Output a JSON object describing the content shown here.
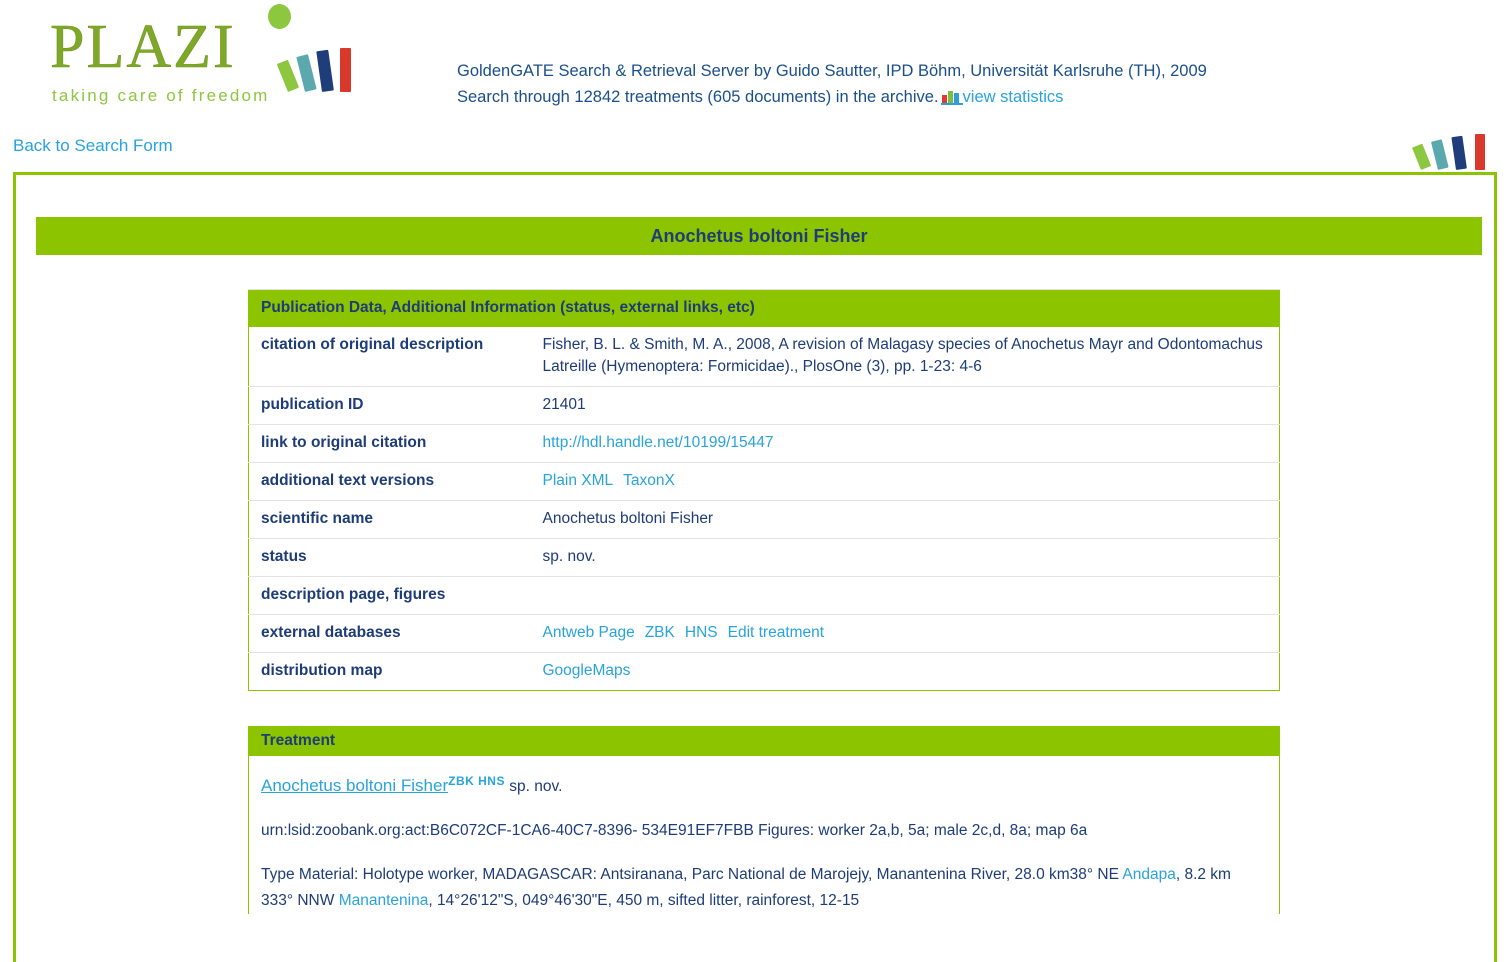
{
  "header": {
    "logo_word": "PLAZI",
    "logo_tagline": "taking care of freedom",
    "server_line": "GoldenGATE Search & Retrieval Server by Guido Sautter, IPD Böhm, Universität Karlsruhe (TH), 2009",
    "archive_line": "Search through 12842 treatments (605 documents) in the archive.",
    "view_statistics": "view statistics",
    "back_to_search": "Back to Search Form"
  },
  "panel": {
    "taxon_title": "Anochetus boltoni Fisher"
  },
  "publication": {
    "section_title": "Publication Data, Additional Information (status, external links, etc)",
    "rows": [
      {
        "label": "citation of original description",
        "value": "Fisher, B. L. & Smith, M. A., 2008, A revision of Malagasy species of Anochetus Mayr and Odontomachus Latreille (Hymenoptera: Formicidae)., PlosOne (3), pp. 1-23: 4-6"
      },
      {
        "label": "publication ID",
        "value": "21401"
      },
      {
        "label": "link to original citation",
        "value": "http://hdl.handle.net/10199/15447"
      },
      {
        "label": "additional text versions",
        "value": ""
      },
      {
        "label": "scientific name",
        "value": "Anochetus boltoni Fisher"
      },
      {
        "label": "status",
        "value": "sp. nov."
      },
      {
        "label": "description page, figures",
        "value": ""
      },
      {
        "label": "external databases",
        "value": ""
      },
      {
        "label": "distribution map",
        "value": ""
      }
    ],
    "text_version_links": [
      "Plain XML",
      "TaxonX"
    ],
    "external_db_links": [
      "Antweb Page",
      "ZBK",
      "HNS",
      "Edit treatment"
    ],
    "distribution_map_link": "GoogleMaps"
  },
  "treatment": {
    "section_title": "Treatment",
    "name": "Anochetus boltoni Fisher",
    "superscript": "ZBK HNS",
    "status": "sp. nov.",
    "urn_paragraph": "urn:lsid:zoobank.org:act:B6C072CF-1CA6-40C7-8396- 534E91EF7FBB Figures: worker 2a,b, 5a; male 2c,d, 8a; map 6a",
    "type_material_part1": "Type Material: Holotype worker, MADAGASCAR: Antsiranana, Parc National de Marojejy, Manantenina River, 28.0 km38° NE ",
    "type_material_link1": "Andapa",
    "type_material_part2": ", 8.2 km 333° NNW ",
    "type_material_link2": "Manantenina",
    "type_material_part3": ", 14°26'12\"S, 049°46'30\"E, 450 m, sifted litter, rainforest, 12-15"
  },
  "colors": {
    "green": "#8dc400",
    "link_blue": "#29a3dc",
    "navy": "#1d3c78",
    "logo_green": "#8dc63f"
  }
}
